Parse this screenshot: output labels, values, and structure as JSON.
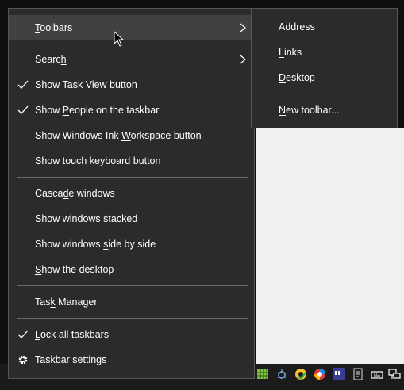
{
  "menu": {
    "items": [
      {
        "pre": "",
        "acc": "T",
        "post": "oolbars",
        "checked": false,
        "submenu": true,
        "hover": true
      },
      {
        "pre": "Searc",
        "acc": "h",
        "post": "",
        "checked": false,
        "submenu": true
      },
      {
        "pre": "Show Task ",
        "acc": "V",
        "post": "iew button",
        "checked": true
      },
      {
        "pre": "Show ",
        "acc": "P",
        "post": "eople on the taskbar",
        "checked": true
      },
      {
        "pre": "Show Windows Ink ",
        "acc": "W",
        "post": "orkspace button",
        "checked": false
      },
      {
        "pre": "Show touch ",
        "acc": "k",
        "post": "eyboard button",
        "checked": false
      },
      {
        "pre": "Casca",
        "acc": "d",
        "post": "e windows",
        "checked": false
      },
      {
        "pre": "Show windows stack",
        "acc": "e",
        "post": "d",
        "checked": false
      },
      {
        "pre": "Show windows ",
        "acc": "s",
        "post": "ide by side",
        "checked": false
      },
      {
        "pre": "",
        "acc": "S",
        "post": "how the desktop",
        "checked": false
      },
      {
        "pre": "Tas",
        "acc": "k",
        "post": " Manager",
        "checked": false
      },
      {
        "pre": "",
        "acc": "L",
        "post": "ock all taskbars",
        "checked": true
      },
      {
        "pre": "Taskbar se",
        "acc": "t",
        "post": "tings",
        "checked": false,
        "gear": true
      }
    ]
  },
  "submenu": {
    "items": [
      {
        "pre": "",
        "acc": "A",
        "post": "ddress"
      },
      {
        "pre": "",
        "acc": "L",
        "post": "inks"
      },
      {
        "pre": "",
        "acc": "D",
        "post": "esktop"
      },
      {
        "pre": "",
        "acc": "N",
        "post": "ew toolbar..."
      }
    ]
  },
  "tray_icons": [
    "grid-app-icon",
    "bug-icon",
    "chrome-canary-icon",
    "color-wheel-icon",
    "quotes-app-icon",
    "document-icon",
    "keyboard-icon",
    "network-icon"
  ],
  "colors": {
    "menu_bg": "#2b2b2b",
    "hover_bg": "#414141",
    "text": "#ffffff",
    "separator": "#6a6a6a"
  }
}
